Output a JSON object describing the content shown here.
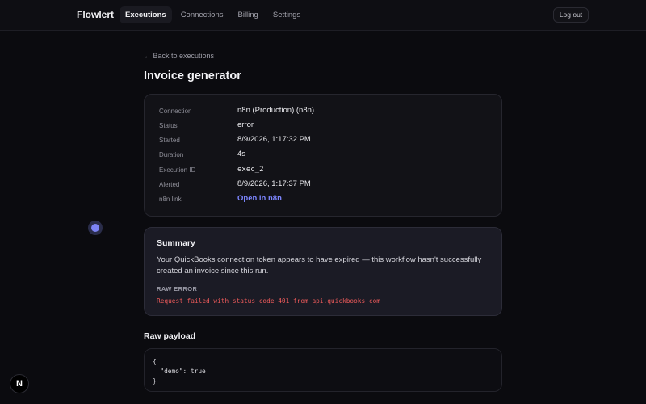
{
  "app": {
    "name": "Flowlert"
  },
  "nav": [
    {
      "label": "Executions",
      "active": true
    },
    {
      "label": "Connections",
      "active": false
    },
    {
      "label": "Billing",
      "active": false
    },
    {
      "label": "Settings",
      "active": false
    }
  ],
  "header": {
    "logout_label": "Log out"
  },
  "page": {
    "back_label": "← Back to executions",
    "title": "Invoice generator"
  },
  "details": {
    "connection": {
      "label": "Connection",
      "value": "n8n (Production) (n8n)"
    },
    "status": {
      "label": "Status",
      "value": "error"
    },
    "started": {
      "label": "Started",
      "value": "8/9/2026, 1:17:32 PM"
    },
    "duration": {
      "label": "Duration",
      "value": "4s"
    },
    "execution_id": {
      "label": "Execution ID",
      "value": "exec_2"
    },
    "alerted": {
      "label": "Alerted",
      "value": "8/9/2026, 1:17:37 PM"
    },
    "n8n_link": {
      "label": "n8n link",
      "value": "Open in n8n"
    }
  },
  "summary": {
    "title": "Summary",
    "text": "Your QuickBooks connection token appears to have expired — this workflow hasn't successfully created an invoice since this run.",
    "raw_error_label": "RAW ERROR",
    "raw_error": "Request failed with status code 401 from api.quickbooks.com"
  },
  "payload": {
    "title": "Raw payload",
    "code": "{\n  \"demo\": true\n}"
  },
  "badge": {
    "label": "N"
  },
  "colors": {
    "accent": "#7d86ff",
    "error": "#ef5b5b",
    "background": "#0b0b0f"
  },
  "icons": {
    "floating_dot": "status-dot-icon",
    "badge": "nextjs-badge-icon"
  }
}
